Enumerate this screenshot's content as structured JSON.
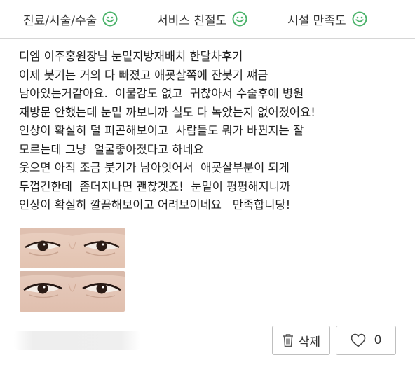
{
  "ratings": [
    {
      "label": "진료/시술/수술",
      "icon": "smile-face-icon",
      "color": "#4cb36b"
    },
    {
      "label": "서비스 친절도",
      "icon": "smile-face-icon",
      "color": "#4cb36b"
    },
    {
      "label": "시설 만족도",
      "icon": "smile-face-icon",
      "color": "#4cb36b"
    }
  ],
  "review": {
    "lines": [
      "디엠 이주홍원장님 눈밑지방재배치 한달차후기",
      "이제 붓기는 거의 다 빠졌고 애굣살쪽에 잔붓기 쨰금",
      "남아있는거같아요.  이물감도 없고  귀찮아서 수술후에 병원",
      "재방문 안했는데 눈밑 까보니까 실도 다 녹았는지 없어졌어요!",
      "인상이 확실히 덜 피곤해보이고  사람들도 뭐가 바뀐지는 잘",
      "모르는데 그냥  얼굴좋아졌다고 하네요",
      "웃으면 아직 조금 붓기가 남아잇어서  애굣살부분이 되게",
      "두껍긴한데  좀더지나면 괜찮겟죠!  눈밑이 평평해지니까",
      "인상이 확실히 깔끔해보이고 어려보이네요   만족합니당!"
    ]
  },
  "photos": [
    {
      "alt": "eye-photo-1"
    },
    {
      "alt": "eye-photo-2"
    }
  ],
  "actions": {
    "delete_label": "삭제",
    "delete_icon": "trash-icon",
    "like_count": "0",
    "like_icon": "heart-outline-icon"
  }
}
